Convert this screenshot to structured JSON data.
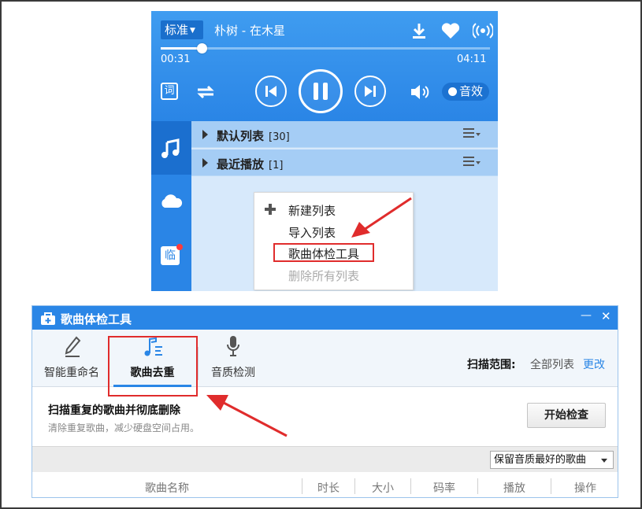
{
  "colors": {
    "accent": "#2a86e6",
    "highlight_box": "#e02c2c",
    "link": "#2a86e6"
  },
  "player": {
    "quality": "标准",
    "song": "朴树 - 在木星",
    "elapsed": "00:31",
    "duration": "04:11",
    "progress": 0.124,
    "lyrics_btn": "词",
    "effect_label": "音效",
    "playlists": [
      {
        "name": "默认列表",
        "count": "[30]"
      },
      {
        "name": "最近播放",
        "count": "[1]"
      }
    ],
    "sidebar_temp": "临",
    "context_menu": {
      "items": [
        {
          "label": "新建列表",
          "enabled": true
        },
        {
          "label": "导入列表",
          "enabled": true
        },
        {
          "label": "歌曲体检工具",
          "enabled": true,
          "highlighted": true
        },
        {
          "label": "删除所有列表",
          "enabled": false
        }
      ]
    }
  },
  "tool": {
    "title": "歌曲体检工具",
    "window_controls": {
      "minimize": "—",
      "close": "✕"
    },
    "tabs": [
      {
        "label": "智能重命名",
        "icon": "pencil-icon",
        "active": false
      },
      {
        "label": "歌曲去重",
        "icon": "music-note-icon",
        "active": true
      },
      {
        "label": "音质检测",
        "icon": "microphone-icon",
        "active": false
      }
    ],
    "scan_label": "扫描范围:",
    "scan_value": "全部列表",
    "scan_change": "更改",
    "heading": "扫描重复的歌曲并彻底删除",
    "subheading": "清除重复歌曲，减少硬盘空间占用。",
    "start_button": "开始检查",
    "keep_option": "保留音质最好的歌曲",
    "columns": [
      "歌曲名称",
      "时长",
      "大小",
      "码率",
      "播放",
      "操作"
    ]
  }
}
